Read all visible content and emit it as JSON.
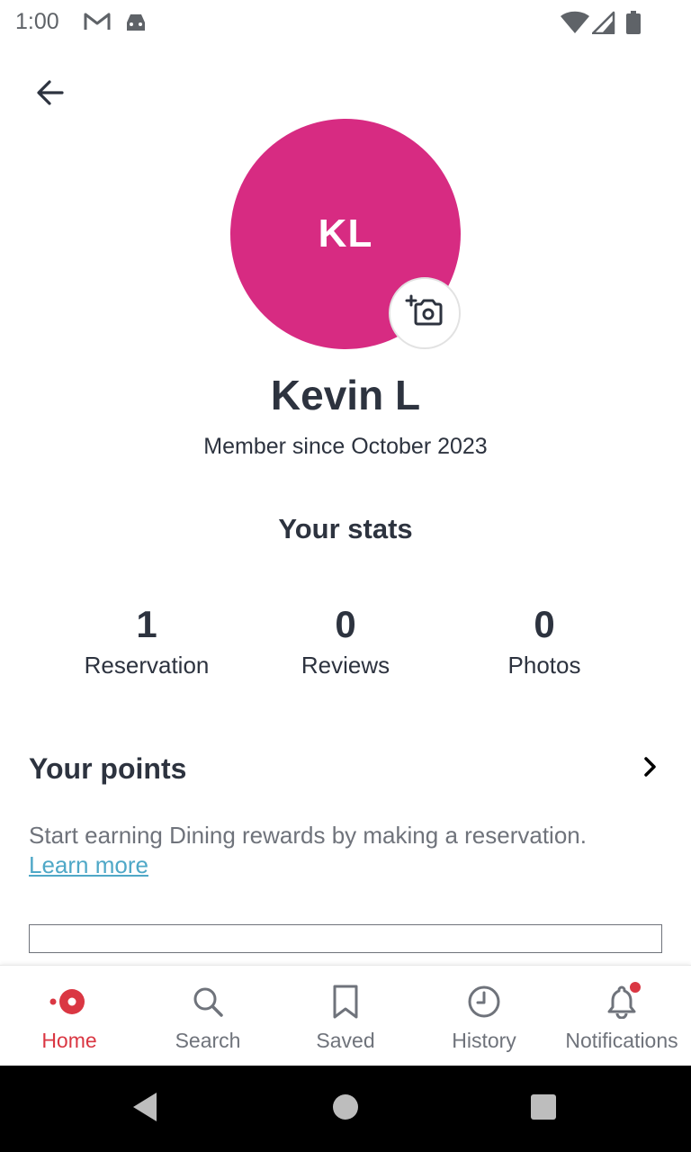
{
  "status_bar": {
    "time": "1:00",
    "icons": [
      "gmail-icon",
      "android-debug-icon",
      "wifi-icon",
      "signal-icon",
      "battery-icon"
    ]
  },
  "header": {
    "back_icon": "arrow-left-icon"
  },
  "profile": {
    "initials": "KL",
    "avatar_color": "#d72b82",
    "name": "Kevin L",
    "member_since": "Member since October 2023",
    "camera_icon": "add-photo-camera-icon"
  },
  "stats": {
    "heading": "Your stats",
    "items": [
      {
        "value": "1",
        "label": "Reservation"
      },
      {
        "value": "0",
        "label": "Reviews"
      },
      {
        "value": "0",
        "label": "Photos"
      }
    ]
  },
  "points": {
    "title": "Your points",
    "description": "Start earning Dining rewards by making a reservation.",
    "link": "Learn more"
  },
  "bottom_nav": {
    "items": [
      {
        "label": "Home",
        "icon": "home-dot-icon",
        "active": true
      },
      {
        "label": "Search",
        "icon": "search-icon",
        "active": false
      },
      {
        "label": "Saved",
        "icon": "bookmark-icon",
        "active": false
      },
      {
        "label": "History",
        "icon": "clock-icon",
        "active": false
      },
      {
        "label": "Notifications",
        "icon": "bell-icon",
        "active": false,
        "badge": true
      }
    ]
  },
  "colors": {
    "accent": "#da3743",
    "text": "#2d333f",
    "link": "#4fa8c7"
  }
}
